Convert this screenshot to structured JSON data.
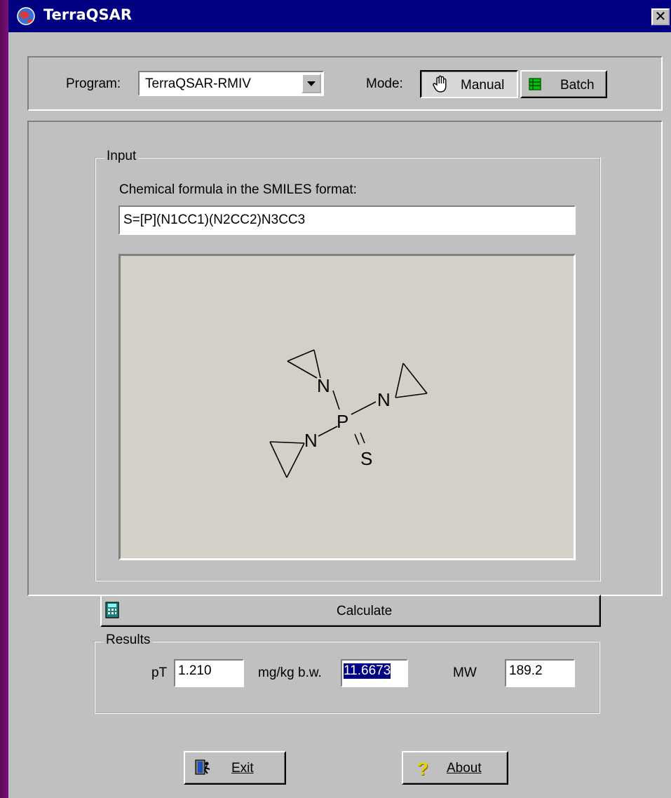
{
  "window": {
    "title": "TerraQSAR",
    "close_label": "✕"
  },
  "toolbar": {
    "program_label": "Program:",
    "program_value": "TerraQSAR-RMIV",
    "mode_label": "Mode:",
    "manual_label": "Manual",
    "batch_label": "Batch"
  },
  "input": {
    "group_title": "Input",
    "smiles_label": "Chemical formula in the SMILES format:",
    "smiles_value": "S=[P](N1CC1)(N2CC2)N3CC3",
    "structure_atoms": [
      "N",
      "N",
      "N",
      "P",
      "S"
    ]
  },
  "calculate_label": "Calculate",
  "results": {
    "group_title": "Results",
    "pt_label": "pT",
    "pt_value": "1.210",
    "mgkg_label": "mg/kg b.w.",
    "mgkg_value": "11.6673",
    "mw_label": "MW",
    "mw_value": "189.2"
  },
  "footer": {
    "exit_label": "Exit",
    "about_label": "About"
  }
}
